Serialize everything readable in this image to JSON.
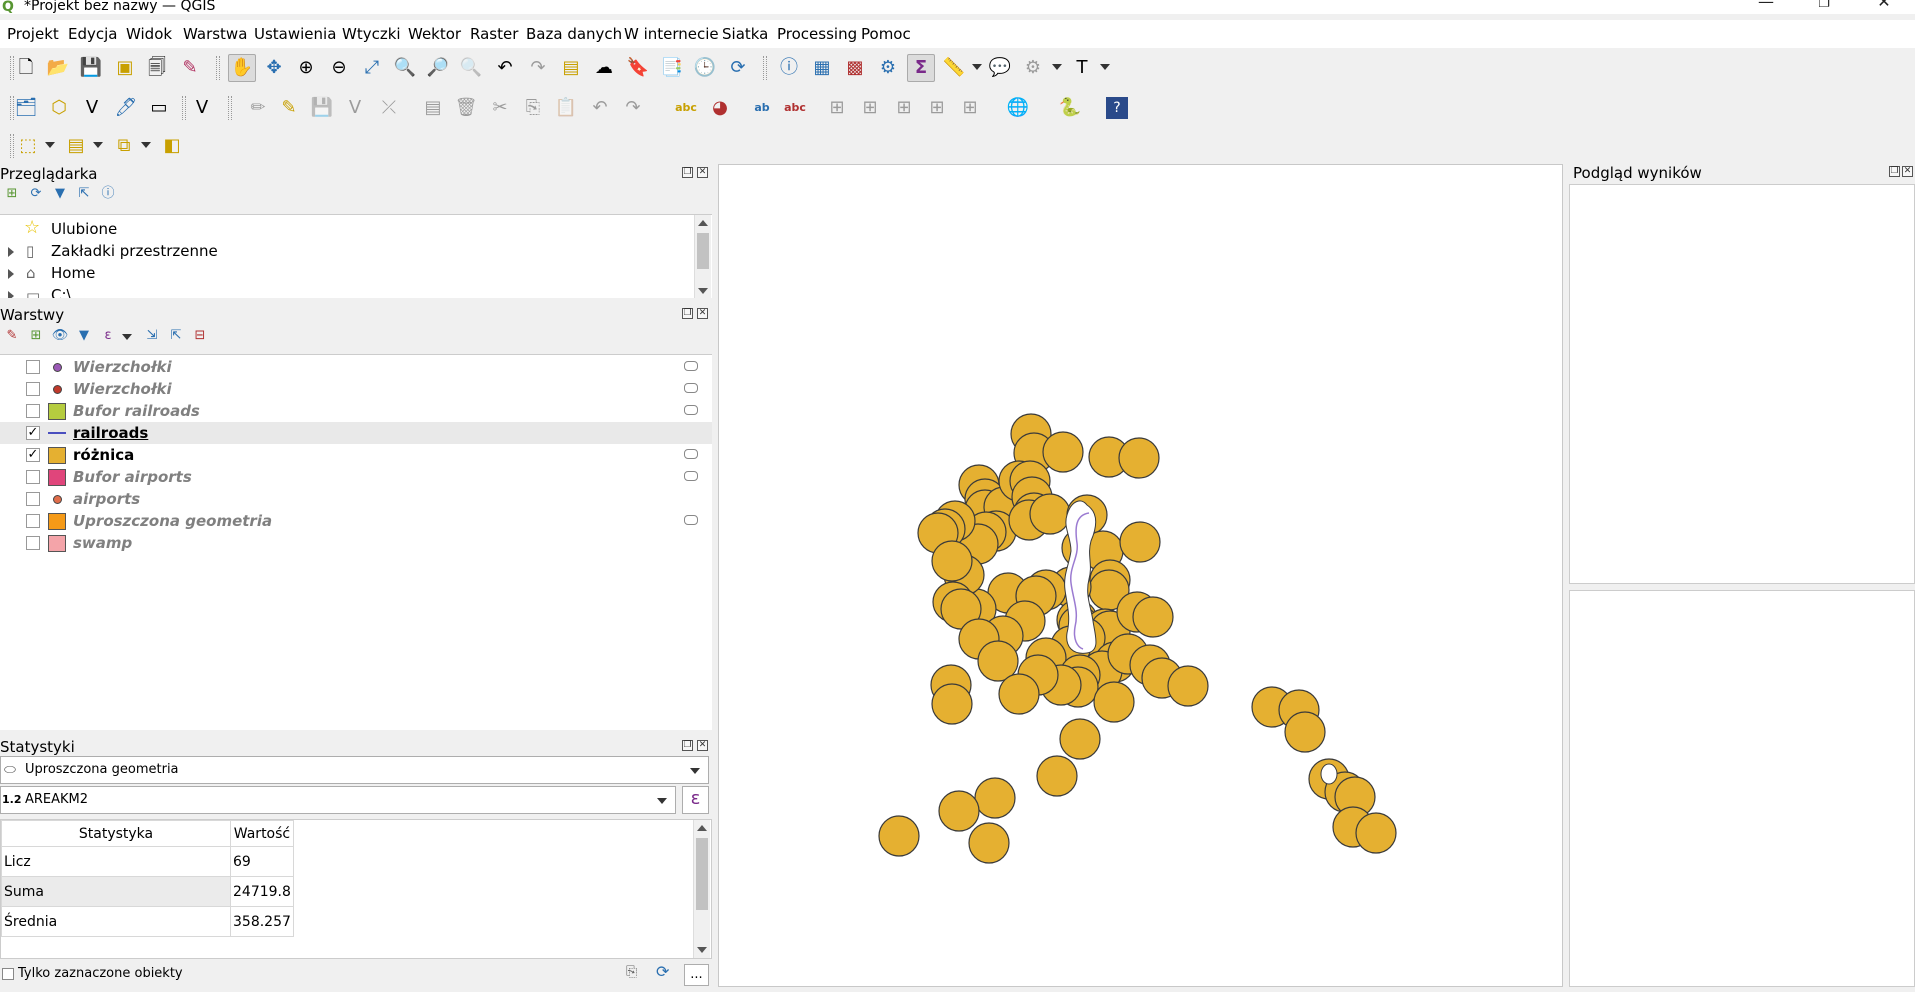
{
  "window": {
    "title": "*Projekt bez nazwy — QGIS",
    "logo": "Q",
    "minimize": "—",
    "restore": "❐",
    "close": "✕"
  },
  "menu": [
    "Projekt",
    "Edycja",
    "Widok",
    "Warstwa",
    "Ustawienia",
    "Wtyczki",
    "Wektor",
    "Raster",
    "Baza danych",
    "W internecie",
    "Siatka",
    "Processing",
    "Pomoc"
  ],
  "browser": {
    "title": "Przeglądarka",
    "items": [
      {
        "label": "Ulubione",
        "icon": "star-icon"
      },
      {
        "label": "Zakładki przestrzenne",
        "icon": "bookmark-icon"
      },
      {
        "label": "Home",
        "icon": "home-icon"
      },
      {
        "label": "C:\\",
        "icon": "folder-icon"
      }
    ]
  },
  "layers": {
    "title": "Warstwy",
    "items": [
      {
        "name": "Wierzchołki",
        "visible": false,
        "symbol": "dot",
        "color": "#9b59b6"
      },
      {
        "name": "Wierzchołki",
        "visible": false,
        "symbol": "dot",
        "color": "#c0392b"
      },
      {
        "name": "Bufor railroads",
        "visible": false,
        "symbol": "fill",
        "color": "#b5cc3f"
      },
      {
        "name": "railroads",
        "visible": true,
        "symbol": "line",
        "color": "#4a4fbf"
      },
      {
        "name": "różnica",
        "visible": true,
        "symbol": "fill",
        "color": "#e5b031"
      },
      {
        "name": "Bufor airports",
        "visible": false,
        "symbol": "fill",
        "color": "#e0457b"
      },
      {
        "name": "airports",
        "visible": false,
        "symbol": "dot",
        "color": "#e06d4a"
      },
      {
        "name": "Uproszczona geometria",
        "visible": false,
        "symbol": "fill",
        "color": "#f59a17"
      },
      {
        "name": "swamp",
        "visible": false,
        "symbol": "fill",
        "color": "#f4a4a9"
      }
    ]
  },
  "stats": {
    "title": "Statystyki",
    "layer": "Uproszczona geometria",
    "field_type": "1.2",
    "field": "AREAKM2",
    "expr_button": "ε",
    "col_stat": "Statystyka",
    "col_value": "Wartość",
    "rows": [
      {
        "stat": "Licz",
        "value": "69"
      },
      {
        "stat": "Suma",
        "value": "24719.8"
      },
      {
        "stat": "Średnia",
        "value": "358.257"
      }
    ],
    "selected_only": "Tylko zaznaczone obiekty",
    "more_button": "..."
  },
  "results": {
    "title": "Podgląd wyników"
  },
  "colors": {
    "buffer_fill": "#e5b031",
    "buffer_stroke": "#3a3a3a",
    "railroad": "#9b7bd1"
  }
}
